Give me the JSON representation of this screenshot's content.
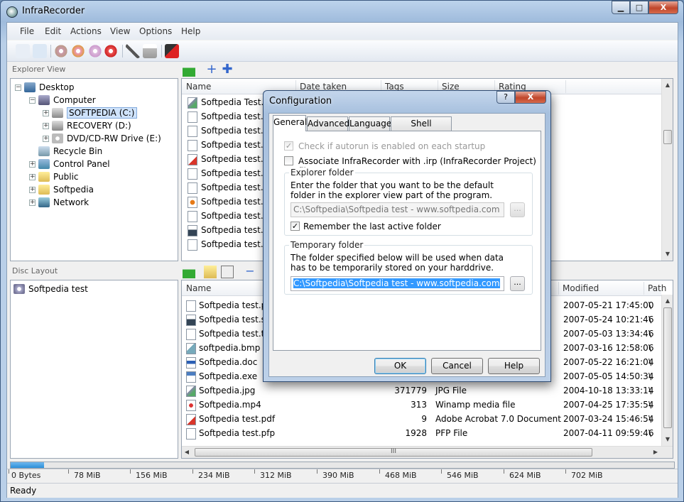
{
  "app": {
    "title": "InfraRecorder",
    "window_controls": {
      "minimize": "▁",
      "maximize": "□",
      "close": "X"
    }
  },
  "menu": [
    "File",
    "Edit",
    "Actions",
    "View",
    "Options",
    "Help"
  ],
  "toolbar_icons": [
    "new-project-icon",
    "open-project-icon",
    "burn-image-icon",
    "copy-disc-icon",
    "erase-disc-icon",
    "burn-disc-icon",
    "tools-icon",
    "drive-icon",
    "exit-icon"
  ],
  "explorer": {
    "label": "Explorer View",
    "tree": [
      {
        "label": "Desktop",
        "icon": "desktop-icon"
      },
      {
        "label": "Computer",
        "icon": "computer-icon"
      },
      {
        "label": "SOFTPEDIA (C:)",
        "icon": "drive-icon",
        "selected": true
      },
      {
        "label": "RECOVERY (D:)",
        "icon": "drive-icon"
      },
      {
        "label": "DVD/CD-RW Drive (E:)",
        "icon": "optical-drive-icon"
      },
      {
        "label": "Recycle Bin",
        "icon": "recycle-bin-icon"
      },
      {
        "label": "Control Panel",
        "icon": "control-panel-icon"
      },
      {
        "label": "Public",
        "icon": "folder-icon"
      },
      {
        "label": "Softpedia",
        "icon": "folder-icon"
      },
      {
        "label": "Network",
        "icon": "network-icon"
      }
    ],
    "columns": [
      "Name",
      "Date taken",
      "Tags",
      "Size",
      "Rating"
    ],
    "files": [
      {
        "name": "Softpedia Test.jp",
        "icon": "jpg"
      },
      {
        "name": "Softpedia test.mc",
        "icon": ""
      },
      {
        "name": "Softpedia test.ns",
        "icon": ""
      },
      {
        "name": "Softpedia test.os",
        "icon": ""
      },
      {
        "name": "Softpedia test.pd",
        "icon": "pdf"
      },
      {
        "name": "Softpedia test.pfi",
        "icon": ""
      },
      {
        "name": "Softpedia test.pir",
        "icon": ""
      },
      {
        "name": "Softpedia test.pp",
        "icon": "ppt"
      },
      {
        "name": "Softpedia test.ps",
        "icon": ""
      },
      {
        "name": "Softpedia test.sw",
        "icon": "swf"
      },
      {
        "name": "Softpedia test.txt",
        "icon": ""
      }
    ]
  },
  "disc": {
    "label": "Disc Layout",
    "project": "Softpedia test",
    "columns": [
      "Name",
      "Modified",
      "Path"
    ],
    "files": [
      {
        "name": "Softpedia test.pst",
        "size": "",
        "type": "",
        "modified": "2007-05-21 17:45:00",
        "path": "\\",
        "icon": ""
      },
      {
        "name": "Softpedia test.swf",
        "size": "",
        "type": "",
        "modified": "2007-05-24 10:21:46",
        "path": "\\",
        "icon": "swf"
      },
      {
        "name": "Softpedia test.txt",
        "size": "",
        "type": "",
        "modified": "2007-05-03 13:34:46",
        "path": "\\",
        "icon": ""
      },
      {
        "name": "softpedia.bmp",
        "size": "",
        "type": "",
        "modified": "2007-03-16 12:58:06",
        "path": "\\",
        "icon": "bmp"
      },
      {
        "name": "Softpedia.doc",
        "size": "",
        "type": "",
        "modified": "2007-05-22 16:21:04",
        "path": "\\",
        "icon": "doc"
      },
      {
        "name": "Softpedia.exe",
        "size": "",
        "type": "",
        "modified": "2007-05-05 14:50:34",
        "path": "\\",
        "icon": "exe"
      },
      {
        "name": "Softpedia.jpg",
        "size": "371779",
        "type": "JPG File",
        "modified": "2004-10-18 13:33:14",
        "path": "\\",
        "icon": "jpg"
      },
      {
        "name": "Softpedia.mp4",
        "size": "313",
        "type": "Winamp media file",
        "modified": "2007-04-25 17:35:54",
        "path": "\\",
        "icon": "mp4"
      },
      {
        "name": "Softpedia test.pdf",
        "size": "9",
        "type": "Adobe Acrobat 7.0 Document",
        "modified": "2007-03-24 15:46:54",
        "path": "\\",
        "icon": "pdf"
      },
      {
        "name": "Softpedia test.pfp",
        "size": "1928",
        "type": "PFP File",
        "modified": "2007-04-11 09:59:46",
        "path": "\\",
        "icon": ""
      }
    ],
    "hscroll_grip": "III"
  },
  "capacity": {
    "used_fraction": 0.05,
    "scale": [
      "0 Bytes",
      "78 MiB",
      "156 MiB",
      "234 MiB",
      "312 MiB",
      "390 MiB",
      "468 MiB",
      "546 MiB",
      "624 MiB",
      "702 MiB"
    ]
  },
  "status": "Ready",
  "dialog": {
    "title": "Configuration",
    "help_glyph": "?",
    "close_glyph": "X",
    "tabs": [
      "General",
      "Advanced",
      "Language",
      "Shell Extension"
    ],
    "active_tab": 0,
    "autorun_label": "Check if autorun is enabled on each startup",
    "autorun_checked": true,
    "autorun_enabled": false,
    "associate_label": "Associate InfraRecorder with .irp (InfraRecorder Project) files",
    "associate_checked": false,
    "explorer_group": {
      "title": "Explorer folder",
      "description": "Enter the folder that you want to be the default folder in the explorer view part of the program.",
      "value": "C:\\Softpedia\\Softpedia test - www.softpedia.com",
      "browse": "...",
      "remember_label": "Remember the last active folder",
      "remember_checked": true
    },
    "temp_group": {
      "title": "Temporary folder",
      "description": "The folder specified below will be used when data has to be temporarily stored on your harddrive.",
      "value": "C:\\Softpedia\\Softpedia test - www.softpedia.com",
      "browse": "..."
    },
    "buttons": {
      "ok": "OK",
      "cancel": "Cancel",
      "help": "Help"
    }
  }
}
